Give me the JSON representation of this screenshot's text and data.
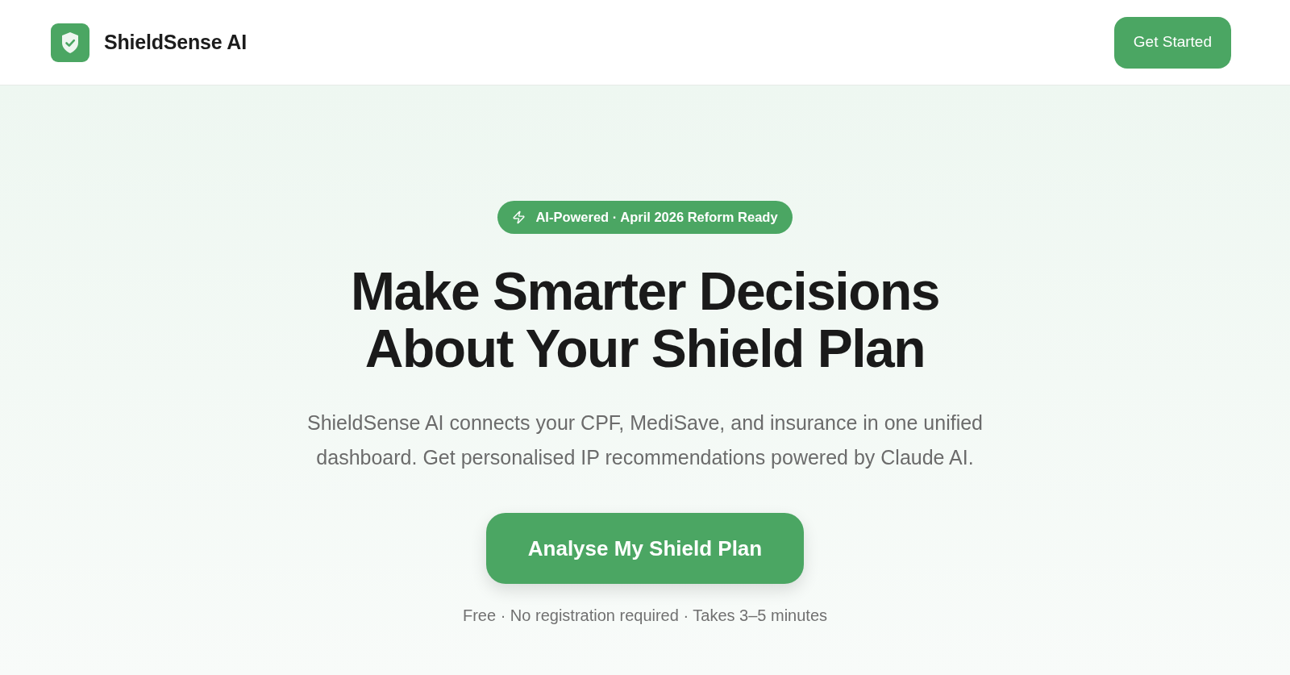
{
  "header": {
    "brand": "ShieldSense AI",
    "cta": "Get Started"
  },
  "hero": {
    "badge": "AI-Powered · April 2026 Reform Ready",
    "title": "Make Smarter Decisions About Your Shield Plan",
    "description": "ShieldSense AI connects your CPF, MediSave, and insurance in one unified dashboard. Get personalised IP recommendations powered by Claude AI.",
    "primary_button": "Analyse My Shield Plan",
    "note": "Free · No registration required · Takes 3–5 minutes"
  }
}
